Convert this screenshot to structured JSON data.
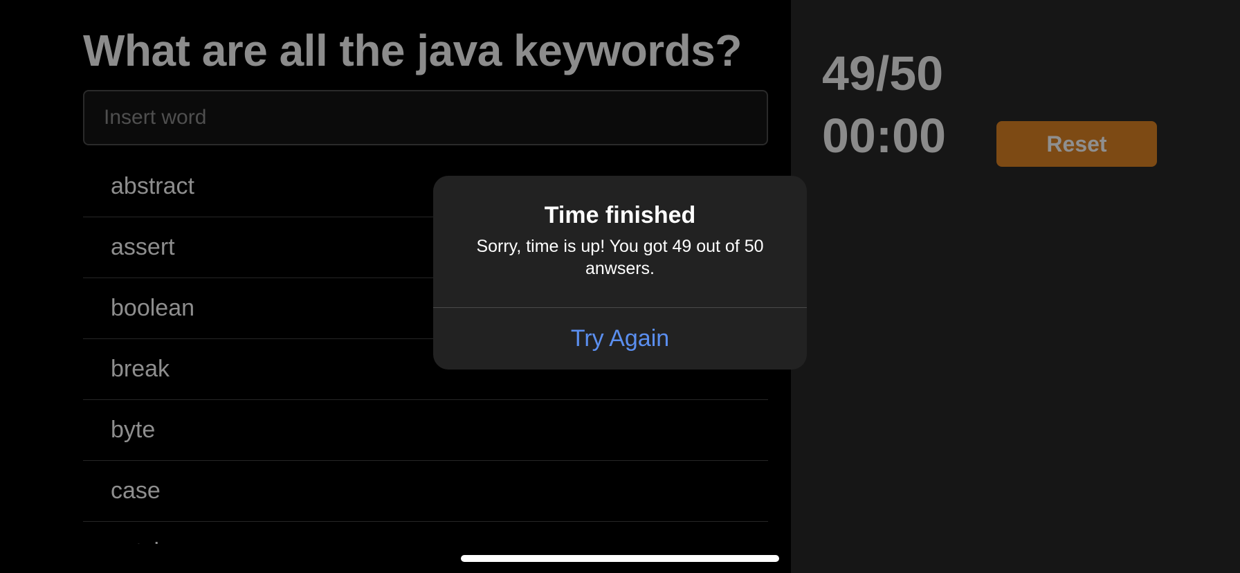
{
  "header": {
    "title": "What are all the java keywords?"
  },
  "search": {
    "placeholder": "Insert word",
    "value": ""
  },
  "words": [
    "abstract",
    "assert",
    "boolean",
    "break",
    "byte",
    "case",
    "catch"
  ],
  "stats": {
    "score": "49/50",
    "timer": "00:00"
  },
  "controls": {
    "reset_label": "Reset"
  },
  "alert": {
    "title": "Time finished",
    "message": "Sorry, time is up! You got 49 out of 50 anwsers.",
    "action_label": "Try Again"
  },
  "colors": {
    "accent_orange": "#7d4a14",
    "link_blue": "#5b8ff0",
    "background_left": "#000000",
    "background_right": "#161616"
  }
}
